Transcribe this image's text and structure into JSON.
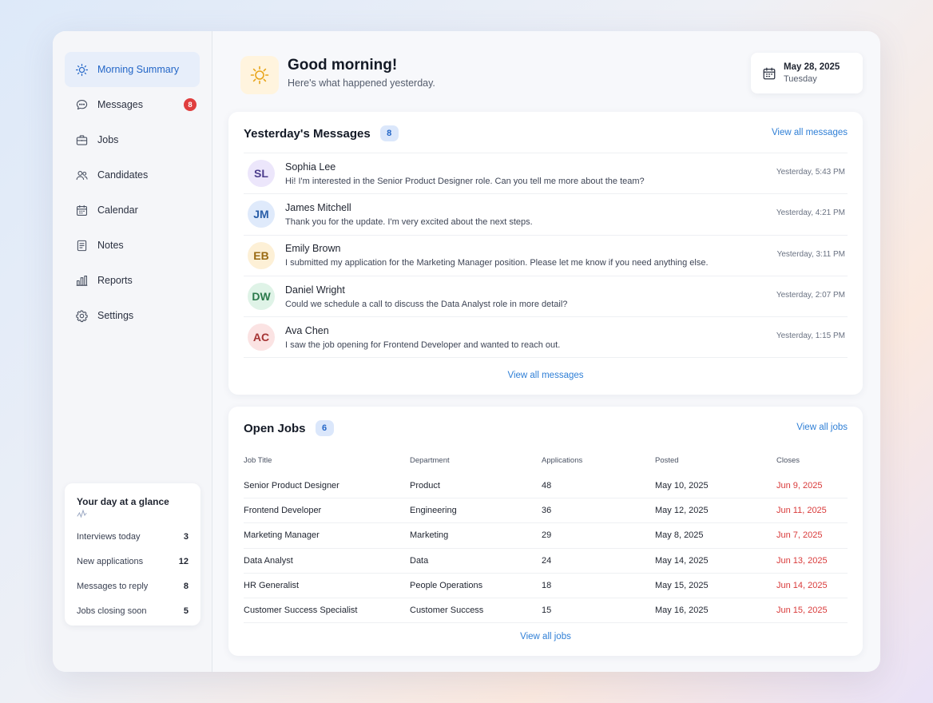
{
  "sidebar": {
    "items": [
      {
        "label": "Morning Summary",
        "icon": "sun-icon",
        "active": true
      },
      {
        "label": "Messages",
        "icon": "chat-icon",
        "badge": "8"
      },
      {
        "label": "Jobs",
        "icon": "briefcase-icon"
      },
      {
        "label": "Candidates",
        "icon": "users-icon"
      },
      {
        "label": "Calendar",
        "icon": "calendar-icon"
      },
      {
        "label": "Notes",
        "icon": "notes-icon"
      },
      {
        "label": "Reports",
        "icon": "bar-chart-icon"
      },
      {
        "label": "Settings",
        "icon": "gear-icon"
      }
    ],
    "glance": {
      "title": "Your day at a glance",
      "rows": [
        {
          "label": "Interviews today",
          "value": "3"
        },
        {
          "label": "New applications",
          "value": "12"
        },
        {
          "label": "Messages to reply",
          "value": "8"
        },
        {
          "label": "Jobs closing soon",
          "value": "5"
        }
      ]
    }
  },
  "header": {
    "title": "Good morning!",
    "subtitle": "Here's what happened yesterday.",
    "date": "May 28, 2025",
    "day": "Tuesday"
  },
  "messages": {
    "title": "Yesterday's Messages",
    "count": "8",
    "view_all_top": "View all messages",
    "view_all_bottom": "View all messages",
    "items": [
      {
        "initials": "SL",
        "name": "Sophia Lee",
        "text": "Hi! I'm interested in the Senior Product Designer role. Can you tell me more about the team?",
        "time": "Yesterday, 5:43 PM",
        "bg": "#ece6fb",
        "fg": "#4b3c8c"
      },
      {
        "initials": "JM",
        "name": "James Mitchell",
        "text": "Thank you for the update. I'm very excited about the next steps.",
        "time": "Yesterday, 4:21 PM",
        "bg": "#dfeafb",
        "fg": "#2a5ea8"
      },
      {
        "initials": "EB",
        "name": "Emily Brown",
        "text": "I submitted my application for the Marketing Manager position. Please let me know if you need anything else.",
        "time": "Yesterday, 3:11 PM",
        "bg": "#fdf0d6",
        "fg": "#9a6a12"
      },
      {
        "initials": "DW",
        "name": "Daniel Wright",
        "text": "Could we schedule a call to discuss the Data Analyst role in more detail?",
        "time": "Yesterday, 2:07 PM",
        "bg": "#dff3e7",
        "fg": "#2c7a4c"
      },
      {
        "initials": "AC",
        "name": "Ava Chen",
        "text": "I saw the job opening for Frontend Developer and wanted to reach out.",
        "time": "Yesterday, 1:15 PM",
        "bg": "#fbe3e3",
        "fg": "#a53434"
      }
    ]
  },
  "jobs": {
    "title": "Open Jobs",
    "count": "6",
    "view_all_top": "View all jobs",
    "view_all_bottom": "View all jobs",
    "columns": [
      "Job Title",
      "Department",
      "Applications",
      "Posted",
      "Closes"
    ],
    "rows": [
      {
        "title": "Senior Product Designer",
        "department": "Product",
        "applications": "48",
        "posted": "May 10, 2025",
        "closes": "Jun 9, 2025"
      },
      {
        "title": "Frontend Developer",
        "department": "Engineering",
        "applications": "36",
        "posted": "May 12, 2025",
        "closes": "Jun 11, 2025"
      },
      {
        "title": "Marketing Manager",
        "department": "Marketing",
        "applications": "29",
        "posted": "May 8, 2025",
        "closes": "Jun 7, 2025"
      },
      {
        "title": "Data Analyst",
        "department": "Data",
        "applications": "24",
        "posted": "May 14, 2025",
        "closes": "Jun 13, 2025"
      },
      {
        "title": "HR Generalist",
        "department": "People Operations",
        "applications": "18",
        "posted": "May 15, 2025",
        "closes": "Jun 14, 2025"
      },
      {
        "title": "Customer Success Specialist",
        "department": "Customer Success",
        "applications": "15",
        "posted": "May 16, 2025",
        "closes": "Jun 15, 2025"
      }
    ]
  },
  "colors": {
    "accent": "#2366c7",
    "link": "#2f7fd6",
    "danger": "#d93a3a"
  }
}
